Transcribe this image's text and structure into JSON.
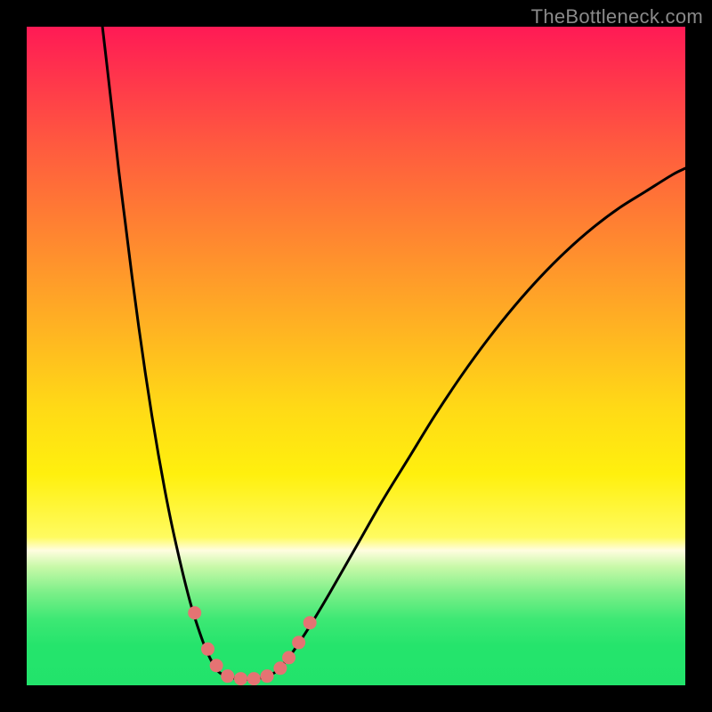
{
  "watermark": "TheBottleneck.com",
  "colors": {
    "frame": "#000000",
    "curve": "#000000",
    "marker_fill": "#e57373",
    "marker_stroke": "#c45a5a",
    "gradient_stops": [
      "#ff1a55",
      "#ff3a4a",
      "#ff5a3f",
      "#ff7a34",
      "#ff9a2a",
      "#ffba20",
      "#ffda16",
      "#fff00e",
      "#fffb60",
      "#fffde0",
      "#c8f9a8",
      "#7aef88",
      "#3de874",
      "#25e46c",
      "#22e36b"
    ]
  },
  "chart_data": {
    "type": "line",
    "title": "",
    "xlabel": "",
    "ylabel": "",
    "xlim": [
      0,
      100
    ],
    "ylim": [
      0,
      100
    ],
    "grid": false,
    "legend": false,
    "series": [
      {
        "name": "left-branch",
        "x": [
          11.5,
          12.2,
          13.0,
          14.0,
          15.0,
          16.0,
          17.0,
          18.0,
          19.0,
          20.0,
          21.0,
          22.0,
          23.0,
          24.0,
          25.0,
          26.0,
          27.0,
          28.0,
          29.0,
          30.0
        ],
        "y": [
          100.0,
          94.0,
          87.0,
          78.0,
          70.0,
          62.0,
          54.5,
          47.5,
          41.0,
          35.0,
          29.5,
          24.5,
          20.0,
          15.8,
          12.0,
          8.8,
          6.0,
          3.8,
          2.2,
          1.5
        ]
      },
      {
        "name": "floor",
        "x": [
          30.0,
          31.0,
          32.0,
          33.0,
          34.0,
          35.0,
          36.0,
          37.0,
          38.0
        ],
        "y": [
          1.5,
          1.2,
          1.0,
          0.9,
          0.9,
          1.0,
          1.2,
          1.6,
          2.2
        ]
      },
      {
        "name": "right-branch",
        "x": [
          38.0,
          40.0,
          43.0,
          46.0,
          50.0,
          54.0,
          58.0,
          62.0,
          66.0,
          70.0,
          74.0,
          78.0,
          82.0,
          86.0,
          90.0,
          94.0,
          98.0,
          100.0
        ],
        "y": [
          2.2,
          4.5,
          9.0,
          14.0,
          21.0,
          28.0,
          34.5,
          41.0,
          47.0,
          52.5,
          57.5,
          62.0,
          66.0,
          69.5,
          72.5,
          75.0,
          77.5,
          78.5
        ]
      }
    ],
    "markers": {
      "name": "highlight-points",
      "points": [
        {
          "x": 25.5,
          "y": 11.0
        },
        {
          "x": 27.5,
          "y": 5.5
        },
        {
          "x": 28.8,
          "y": 3.0
        },
        {
          "x": 30.5,
          "y": 1.4
        },
        {
          "x": 32.5,
          "y": 1.0
        },
        {
          "x": 34.5,
          "y": 1.0
        },
        {
          "x": 36.5,
          "y": 1.4
        },
        {
          "x": 38.5,
          "y": 2.6
        },
        {
          "x": 39.8,
          "y": 4.2
        },
        {
          "x": 41.3,
          "y": 6.5
        },
        {
          "x": 43.0,
          "y": 9.5
        }
      ]
    }
  }
}
